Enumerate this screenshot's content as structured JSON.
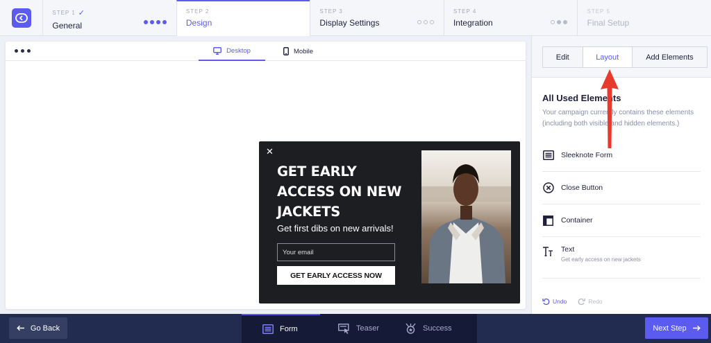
{
  "steps": [
    {
      "num": "STEP 1",
      "title": "General",
      "done": true,
      "check": "✓",
      "dots": [
        "filled",
        "filled",
        "filled",
        "filled"
      ]
    },
    {
      "num": "STEP 2",
      "title": "Design"
    },
    {
      "num": "STEP 3",
      "title": "Display Settings",
      "dots": [
        "empty",
        "empty",
        "empty"
      ]
    },
    {
      "num": "STEP 4",
      "title": "Integration",
      "dots": [
        "empty",
        "grey",
        "grey"
      ]
    },
    {
      "num": "STEP 5",
      "title": "Final Setup"
    }
  ],
  "canvas": {
    "device_tabs": {
      "desktop": "Desktop",
      "mobile": "Mobile"
    }
  },
  "popup": {
    "close": "✕",
    "title": "GET EARLY ACCESS ON NEW JACKETS",
    "subtitle": "Get first dibs on new arrivals!",
    "email_placeholder": "Your email",
    "cta": "GET EARLY ACCESS NOW"
  },
  "right_panel": {
    "tabs": {
      "edit": "Edit",
      "layout": "Layout",
      "add": "Add Elements"
    },
    "title": "All Used Elements",
    "description": "Your campaign currently contains these elements (including both visible and hidden elements.)",
    "elements": [
      {
        "label": "Sleeknote Form",
        "icon": "form-icon"
      },
      {
        "label": "Close Button",
        "icon": "close-circle-icon"
      },
      {
        "label": "Container",
        "icon": "container-icon"
      },
      {
        "label": "Text",
        "sub": "Get early access on new jackets",
        "icon": "text-icon"
      }
    ],
    "undo": "Undo",
    "redo": "Redo"
  },
  "bottom": {
    "back": "Go Back",
    "tabs": {
      "form": "Form",
      "teaser": "Teaser",
      "success": "Success"
    },
    "next": "Next Step"
  },
  "colors": {
    "accent": "#5b5bf0",
    "dark_nav": "#222b50",
    "annotation_arrow": "#e8392d"
  }
}
